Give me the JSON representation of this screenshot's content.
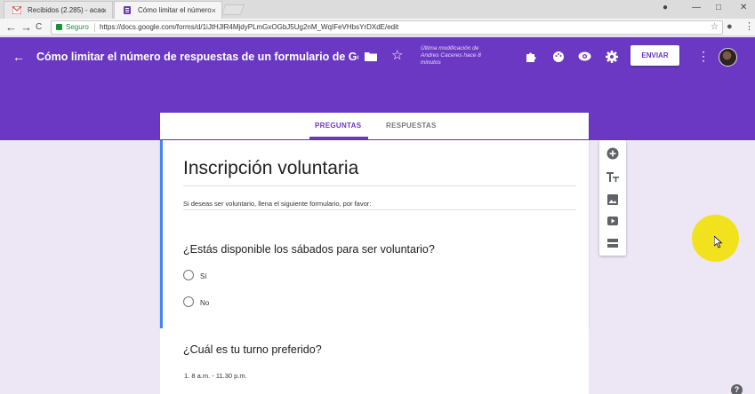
{
  "browser": {
    "tabs": [
      {
        "title": "Recibidos (2.285) - acac",
        "favicon": "gmail-icon",
        "close": "×"
      },
      {
        "title": "Cómo limitar el número",
        "favicon": "forms-icon",
        "close": "×"
      }
    ],
    "controls": {
      "account": "●",
      "minimize": "—",
      "maximize": "□",
      "close": "✕"
    },
    "nav": {
      "back": "←",
      "forward": "→",
      "reload": "C"
    },
    "address": {
      "secure_label": "Seguro",
      "url": "https://docs.google.com/forms/d/1iJtHJlR4MjdyPLmGxOGbJ5Ug2nM_WqIFeVHbsYrDXdE/edit",
      "bookmark": "☆"
    },
    "extension_icon": "●",
    "menu_icon": "⋮"
  },
  "forms_header": {
    "back_icon": "←",
    "title": "Cómo limitar el número de respuestas de un formulario de Googl",
    "folder_icon": "▆",
    "star_icon": "☆",
    "last_modified": "Última modificación de Andres Caceres hace 8 minutos",
    "addons_icon": "✚",
    "palette_icon": "◉",
    "preview_icon": "◉",
    "settings_icon": "✱",
    "send_label": "ENVIAR",
    "more_icon": "⋮",
    "color": "#6b38c4"
  },
  "form_tabs": {
    "questions": "PREGUNTAS",
    "responses": "RESPUESTAS"
  },
  "form": {
    "title": "Inscripción voluntaria",
    "description": "Si deseas ser voluntario, llena el siguiente formulario, por favor:",
    "questions": [
      {
        "text": "¿Estás disponible los sábados para ser voluntario?",
        "options": [
          "Sí",
          "No"
        ]
      },
      {
        "text": "¿Cuál es tu turno preferido?",
        "options": [
          "1.   8 a.m. - 11.30 p.m."
        ]
      }
    ]
  },
  "side_tools": {
    "add_question": "⊕",
    "add_title": "Tт",
    "add_image": "▣",
    "add_video": "▶",
    "add_section": "☰"
  },
  "help": "?"
}
